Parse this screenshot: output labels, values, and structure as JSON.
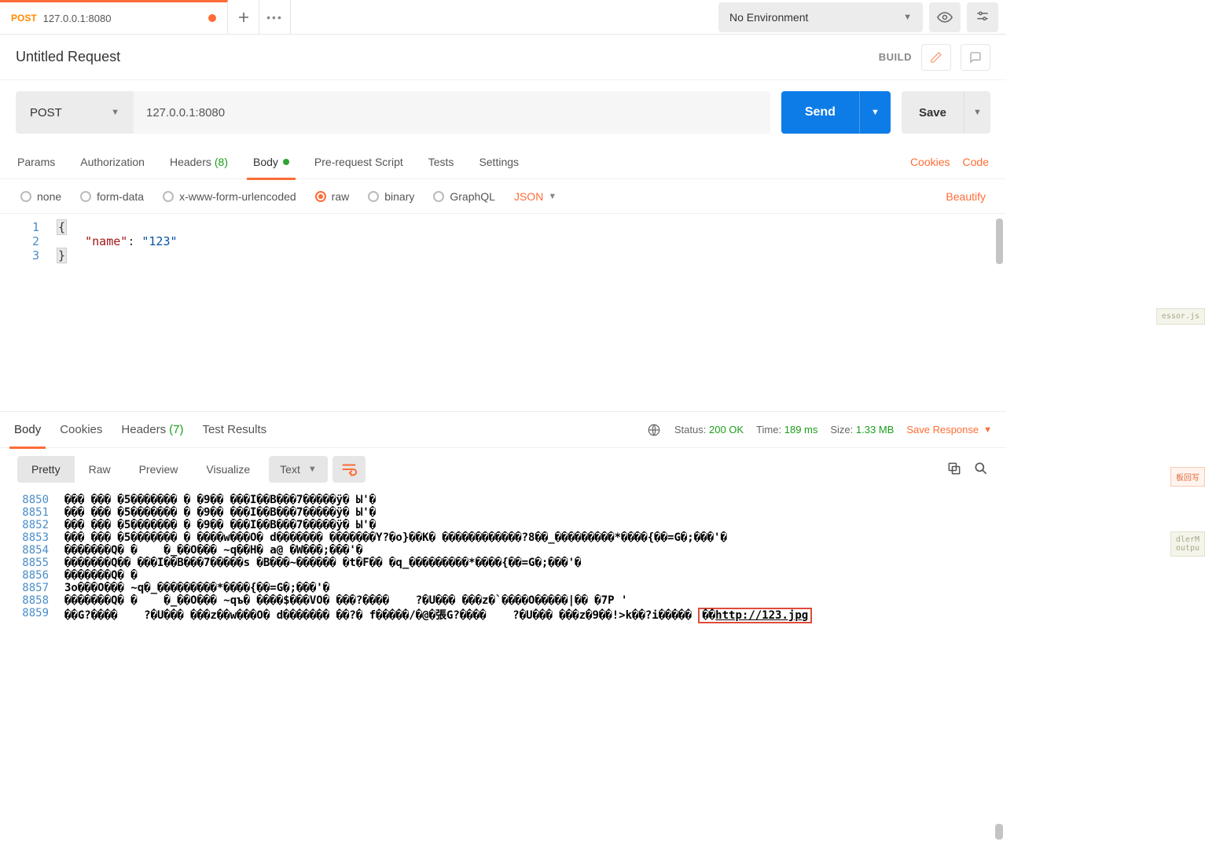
{
  "tab": {
    "method": "POST",
    "title": "127.0.0.1:8080"
  },
  "environment": {
    "label": "No Environment"
  },
  "request": {
    "title": "Untitled Request",
    "build": "BUILD",
    "method": "POST",
    "url": "127.0.0.1:8080"
  },
  "reqTabs": {
    "params": "Params",
    "auth": "Authorization",
    "headers": "Headers",
    "headersCount": "(8)",
    "body": "Body",
    "prereq": "Pre-request Script",
    "tests": "Tests",
    "settings": "Settings",
    "cookies": "Cookies",
    "code": "Code"
  },
  "bodyTypes": {
    "none": "none",
    "formdata": "form-data",
    "urlenc": "x-www-form-urlencoded",
    "raw": "raw",
    "binary": "binary",
    "graphql": "GraphQL",
    "json": "JSON",
    "beautify": "Beautify"
  },
  "editor": {
    "l1": "1",
    "l2": "2",
    "l3": "3",
    "brace_open": "{",
    "brace_close": "}",
    "keyq": "\"name\"",
    "colon": ": ",
    "valq": "\"123\""
  },
  "respTabs": {
    "body": "Body",
    "cookies": "Cookies",
    "headers": "Headers",
    "headersCount": "(7)",
    "tests": "Test Results"
  },
  "respMeta": {
    "statusLabel": "Status:",
    "statusValue": "200 OK",
    "timeLabel": "Time:",
    "timeValue": "189 ms",
    "sizeLabel": "Size:",
    "sizeValue": "1.33 MB",
    "save": "Save Response"
  },
  "viewTabs": {
    "pretty": "Pretty",
    "raw": "Raw",
    "preview": "Preview",
    "visualize": "Visualize"
  },
  "format": {
    "label": "Text"
  },
  "buttons": {
    "send": "Send",
    "save": "Save"
  },
  "respLines": [
    {
      "n": "8850",
      "t": "��� ��� �5������� � �9�� ���I��B���7�����ÿ� Ы'�"
    },
    {
      "n": "8851",
      "t": "��� ��� �5������� � �9�� ���I��B���7�����ÿ� Ы'�"
    },
    {
      "n": "8852",
      "t": "��� ��� �5������� � �9�� ���I��B���7�����ÿ� Ы'�"
    },
    {
      "n": "8853",
      "t": "��� ��� �5������� � ����w���O� d������� �������Y?�o}��K� ������������?8��_���������*����{��=G�;���'�"
    },
    {
      "n": "8854",
      "t": "�������Q� �    �_��O��� ~q��H� a@ �W���;���'�"
    },
    {
      "n": "8855",
      "t": "�������Q�� ���I��B���7�����s �B���~������ �t�F�� �q_���������*����{��=G�;���'�"
    },
    {
      "n": "8856",
      "t": "�������Q� �"
    },
    {
      "n": "8857",
      "t": "3o���O��� ~q�_���������*����{��=G�;���'�"
    },
    {
      "n": "8858",
      "t": "�������Q� �    �_��O��� ~qъ� ����$���VO� ���?����    ?�U��� ���z�`����O�����|�� �7P '"
    },
    {
      "n": "8859",
      "t": "��G?����    ?�U��� ���z��w���O� d������� ��?� f�����/�@�張G?����    ?�U��� ���z�9��!>k��?i�����",
      "hl": "��http://123.jpg"
    }
  ],
  "ghost": {
    "top": "essor.js",
    "mid": "板回写",
    "bot1": "dlerM",
    "bot2": "outpu"
  }
}
